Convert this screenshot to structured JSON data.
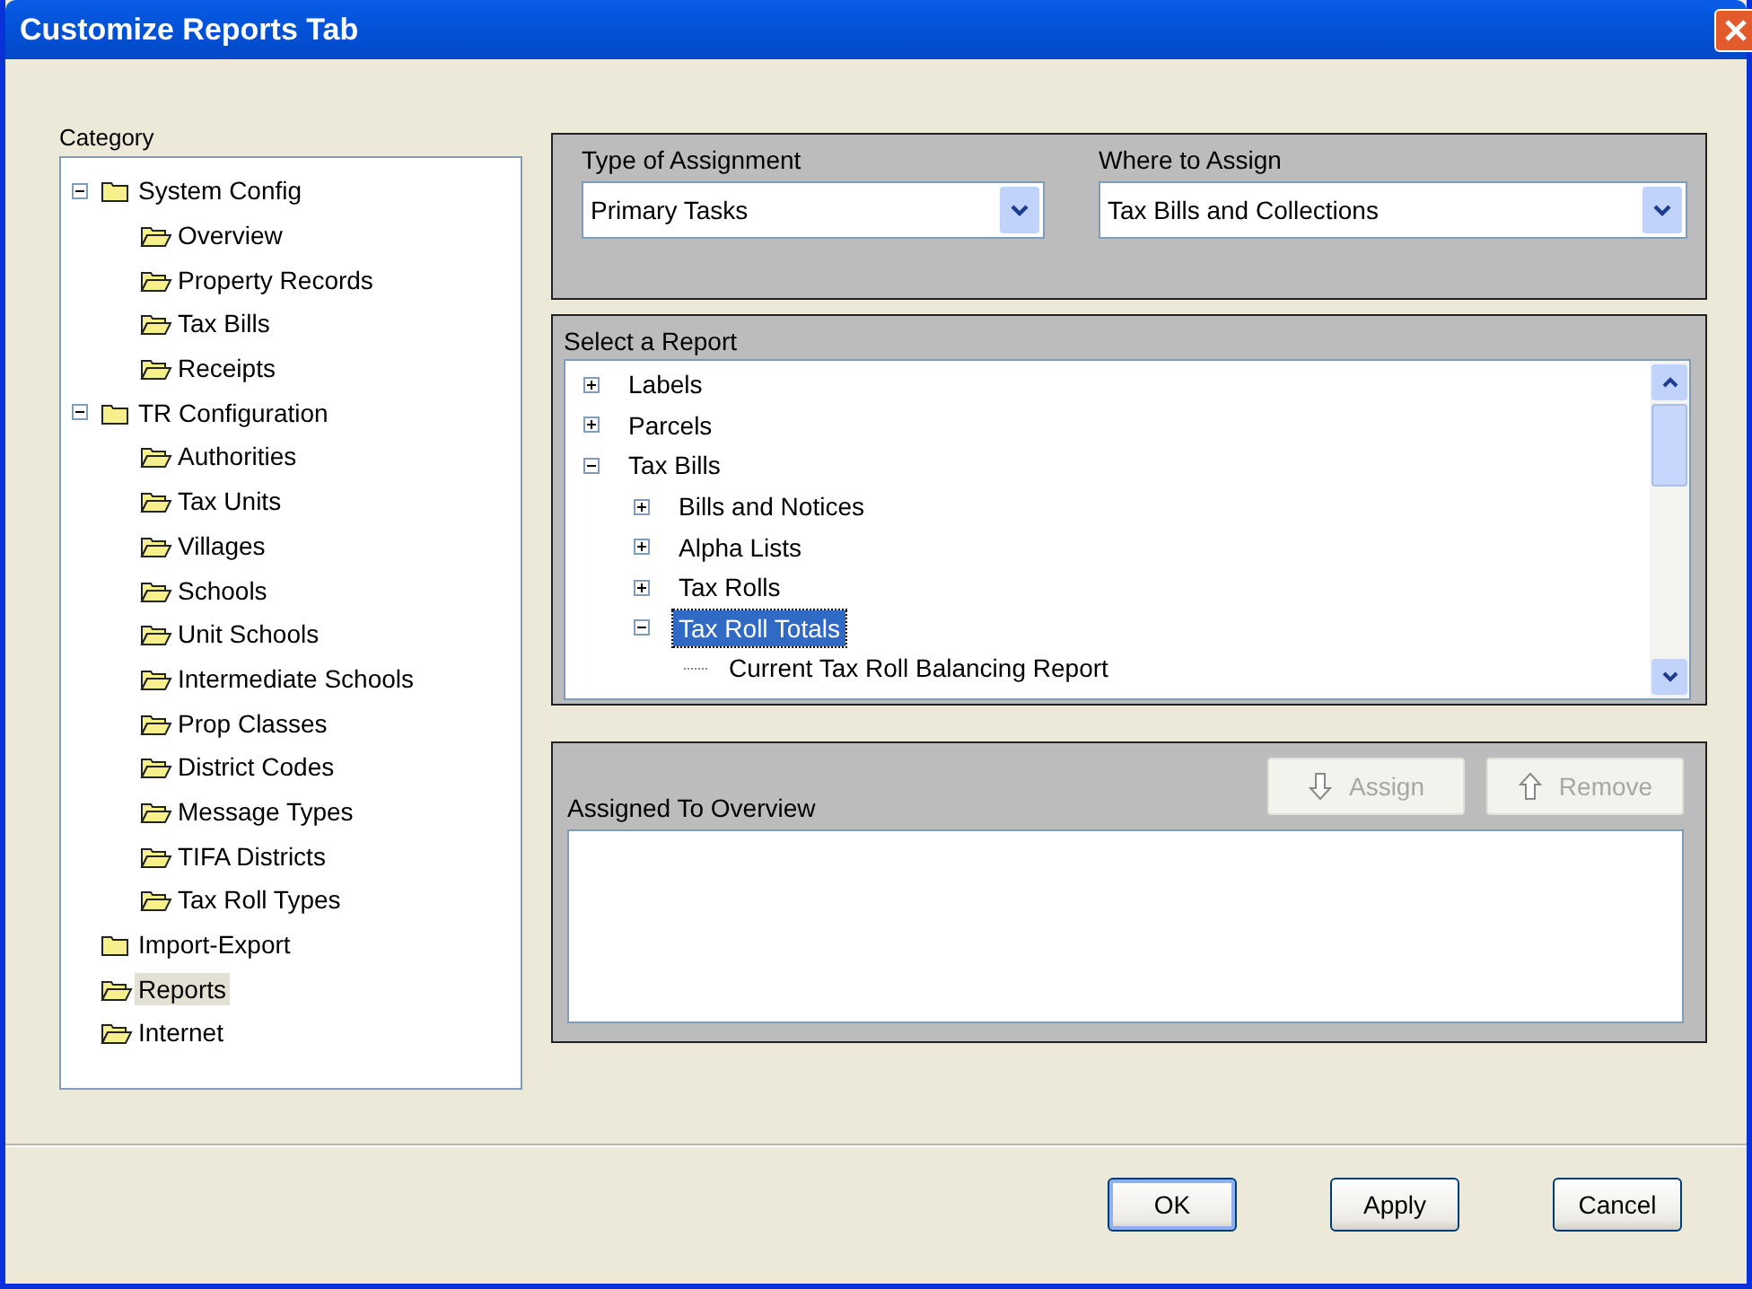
{
  "window": {
    "title": "Customize Reports Tab"
  },
  "category": {
    "label": "Category",
    "items": [
      {
        "label": "System Config",
        "kind": "folder-closed",
        "expanded": true,
        "selected": false,
        "children": [
          {
            "label": "Overview",
            "kind": "folder-open",
            "selected": false
          },
          {
            "label": "Property Records",
            "kind": "folder-open",
            "selected": false
          },
          {
            "label": "Tax Bills",
            "kind": "folder-open",
            "selected": false
          },
          {
            "label": "Receipts",
            "kind": "folder-open",
            "selected": false
          }
        ]
      },
      {
        "label": "TR Configuration",
        "kind": "folder-closed",
        "expanded": true,
        "selected": false,
        "children": [
          {
            "label": "Authorities",
            "kind": "folder-open",
            "selected": false
          },
          {
            "label": "Tax Units",
            "kind": "folder-open",
            "selected": false
          },
          {
            "label": "Villages",
            "kind": "folder-open",
            "selected": false
          },
          {
            "label": "Schools",
            "kind": "folder-open",
            "selected": false
          },
          {
            "label": "Unit Schools",
            "kind": "folder-open",
            "selected": false
          },
          {
            "label": "Intermediate Schools",
            "kind": "folder-open",
            "selected": false
          },
          {
            "label": "Prop Classes",
            "kind": "folder-open",
            "selected": false
          },
          {
            "label": "District Codes",
            "kind": "folder-open",
            "selected": false
          },
          {
            "label": "Message Types",
            "kind": "folder-open",
            "selected": false
          },
          {
            "label": "TIFA Districts",
            "kind": "folder-open",
            "selected": false
          },
          {
            "label": "Tax Roll Types",
            "kind": "folder-open",
            "selected": false
          }
        ]
      },
      {
        "label": "Import-Export",
        "kind": "folder-closed",
        "selected": false
      },
      {
        "label": "Reports",
        "kind": "folder-open",
        "selected": true
      },
      {
        "label": "Internet",
        "kind": "folder-open",
        "selected": false
      }
    ]
  },
  "assignment": {
    "fields": [
      {
        "label": "Type of Assignment",
        "value": "Primary Tasks"
      },
      {
        "label": "Where to Assign",
        "value": "Tax Bills and Collections"
      }
    ]
  },
  "reports": {
    "label": "Select a Report",
    "items": [
      {
        "label": "Labels",
        "expanded": false,
        "selected": false
      },
      {
        "label": "Parcels",
        "expanded": false,
        "selected": false
      },
      {
        "label": "Tax Bills",
        "expanded": true,
        "selected": false,
        "children": [
          {
            "label": "Bills and Notices",
            "expanded": false,
            "selected": false
          },
          {
            "label": "Alpha Lists",
            "expanded": false,
            "selected": false
          },
          {
            "label": "Tax Rolls",
            "expanded": false,
            "selected": false
          },
          {
            "label": "Tax Roll Totals",
            "expanded": true,
            "selected": true,
            "children": [
              {
                "label": "Current Tax Roll Balancing Report",
                "selected": false
              }
            ]
          }
        ]
      }
    ]
  },
  "assigned": {
    "label": "Assigned To Overview",
    "buttons": [
      {
        "label": "Assign",
        "kind": "down",
        "disabled": true
      },
      {
        "label": "Remove",
        "kind": "up",
        "disabled": true
      }
    ]
  },
  "buttons": [
    {
      "label": "OK",
      "default": true
    },
    {
      "label": "Apply",
      "default": false
    },
    {
      "label": "Cancel",
      "default": false
    }
  ]
}
